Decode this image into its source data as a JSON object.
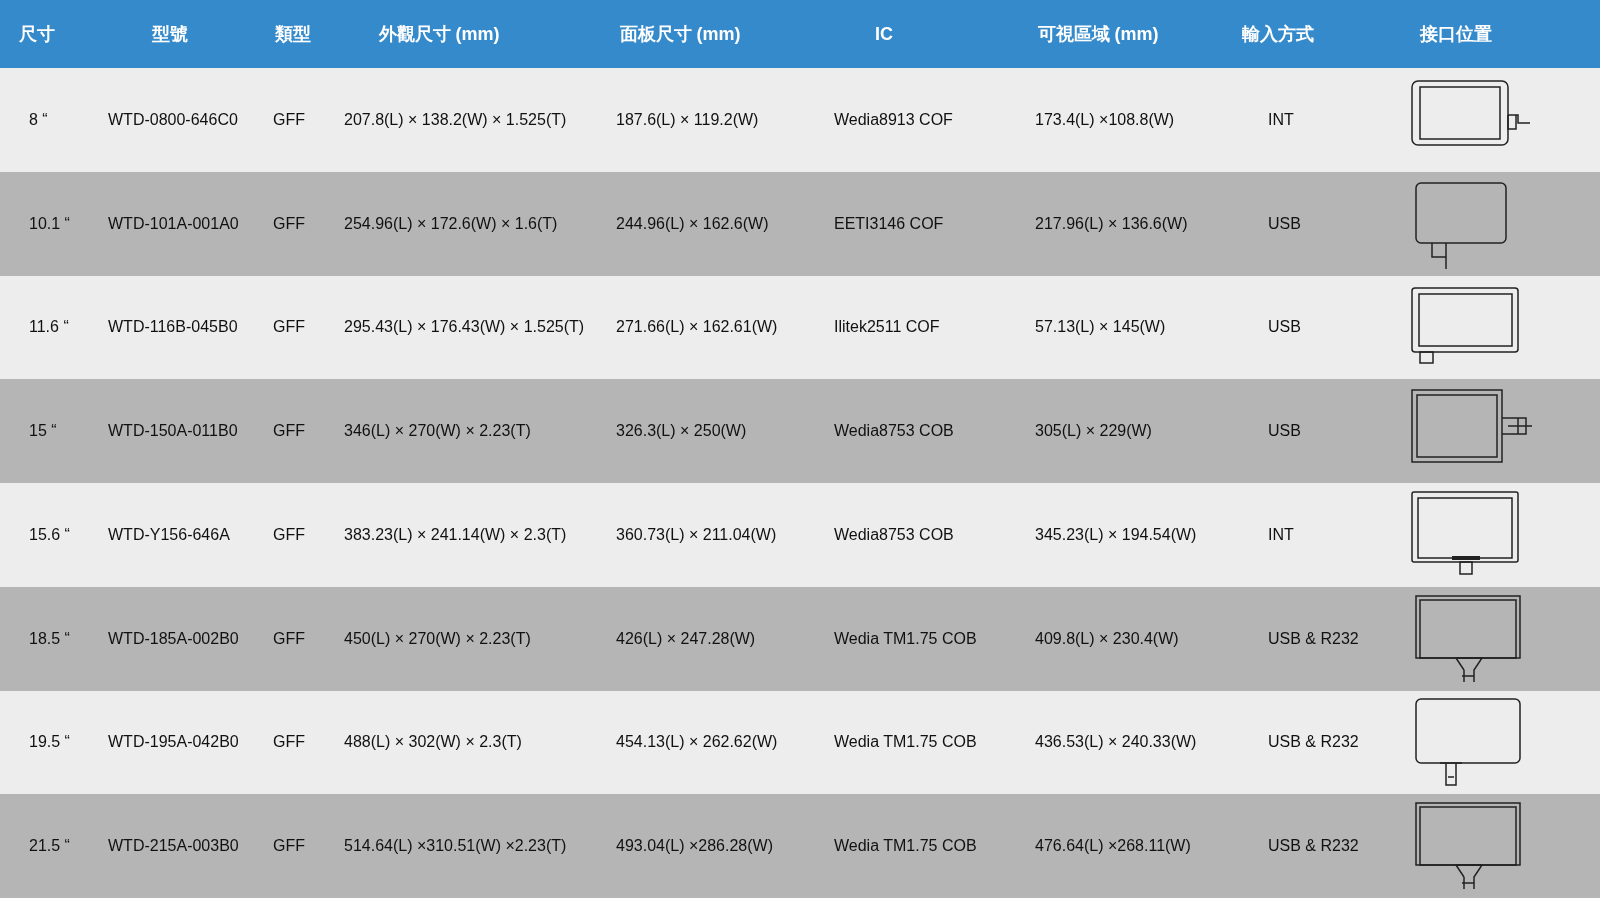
{
  "table": {
    "columns": [
      "尺寸",
      "型號",
      "類型",
      "外觀尺寸 (mm)",
      "面板尺寸 (mm)",
      "IC",
      "可視區域 (mm)",
      "輸入方式",
      "接口位置"
    ],
    "rows": [
      {
        "size": "8 “",
        "model": "WTD-0800-646C0",
        "type": "GFF",
        "outline": "207.8(L) × 138.2(W) × 1.525(T)",
        "panel": "187.6(L) × 119.2(W)",
        "ic": "Wedia8913 COF",
        "visible": "173.4(L) ×108.8(W)",
        "input": "INT",
        "connector": {
          "kind": "side-plug"
        }
      },
      {
        "size": "10.1 “",
        "model": "WTD-101A-001A0",
        "type": "GFF",
        "outline": "254.96(L) × 172.6(W) × 1.6(T)",
        "panel": "244.96(L) × 162.6(W)",
        "ic": "EETI3146 COF",
        "visible": "217.96(L) × 136.6(W)",
        "input": "USB",
        "connector": {
          "kind": "bottom-left-tail"
        }
      },
      {
        "size": "11.6 “",
        "model": "WTD-116B-045B0",
        "type": "GFF",
        "outline": "295.43(L) × 176.43(W) × 1.525(T)",
        "panel": "271.66(L) × 162.61(W)",
        "ic": "Ilitek2511 COF",
        "visible": "57.13(L) × 145(W)",
        "input": "USB",
        "connector": {
          "kind": "bottom-left-tab"
        }
      },
      {
        "size": "15 “",
        "model": "WTD-150A-011B0",
        "type": "GFF",
        "outline": "346(L) × 270(W) × 2.23(T)",
        "panel": "326.3(L) × 250(W)",
        "ic": "Wedia8753 COB",
        "visible": "305(L) × 229(W)",
        "input": "USB",
        "connector": {
          "kind": "side-connector"
        }
      },
      {
        "size": "15.6 “",
        "model": "WTD-Y156-646A",
        "type": "GFF",
        "outline": "383.23(L) × 241.14(W) × 2.3(T)",
        "panel": "360.73(L) × 211.04(W)",
        "ic": "Wedia8753 COB",
        "visible": "345.23(L) × 194.54(W)",
        "input": "INT",
        "connector": {
          "kind": "bottom-center-tab"
        }
      },
      {
        "size": "18.5 “",
        "model": "WTD-185A-002B0",
        "type": "GFF",
        "outline": "450(L) × 270(W) × 2.23(T)",
        "panel": "426(L) × 247.28(W)",
        "ic": "Wedia TM1.75 COB",
        "visible": "409.8(L) × 230.4(W)",
        "input": "USB & R232",
        "connector": {
          "kind": "bottom-center-funnel"
        }
      },
      {
        "size": "19.5 “",
        "model": "WTD-195A-042B0",
        "type": "GFF",
        "outline": "488(L) × 302(W) × 2.3(T)",
        "panel": "454.13(L) × 262.62(W)",
        "ic": "Wedia TM1.75 COB",
        "visible": "436.53(L) × 240.33(W)",
        "input": "USB & R232",
        "connector": {
          "kind": "bottom-left-narrow"
        }
      },
      {
        "size": "21.5 “",
        "model": "WTD-215A-003B0",
        "type": "GFF",
        "outline": "514.64(L) ×310.51(W) ×2.23(T)",
        "panel": "493.04(L) ×286.28(W)",
        "ic": "Wedia TM1.75 COB",
        "visible": "476.64(L) ×268.11(W)",
        "input": "USB & R232",
        "connector": {
          "kind": "bottom-center-funnel"
        }
      }
    ]
  }
}
